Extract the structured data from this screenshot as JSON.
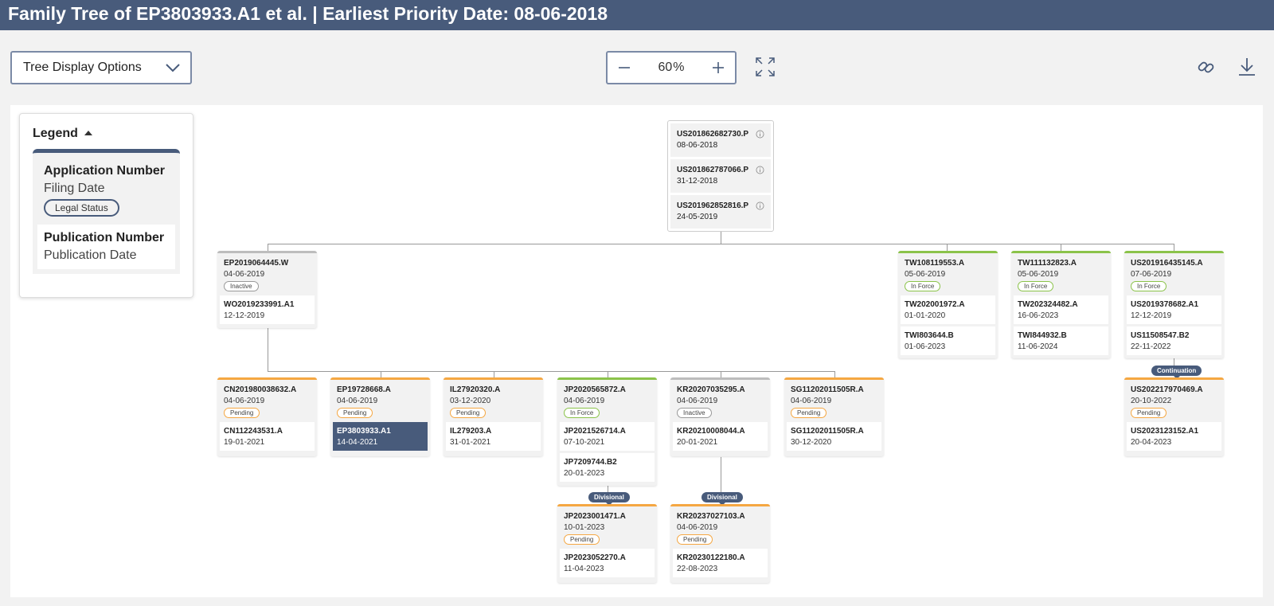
{
  "header": {
    "title": "Family Tree of EP3803933.A1 et al. | Earliest Priority Date: 08-06-2018"
  },
  "toolbar": {
    "tree_options_label": "Tree Display Options",
    "zoom_value": "60",
    "zoom_unit": "%"
  },
  "legend": {
    "title": "Legend",
    "application_number": "Application Number",
    "filing_date": "Filing Date",
    "legal_status": "Legal Status",
    "publication_number": "Publication Number",
    "publication_date": "Publication Date"
  },
  "root": [
    {
      "num": "US201862682730.P",
      "date": "08-06-2018"
    },
    {
      "num": "US201862787066.P",
      "date": "31-12-2018"
    },
    {
      "num": "US201962852816.P",
      "date": "24-05-2019"
    }
  ],
  "nodes": {
    "ep": {
      "num": "EP2019064445.W",
      "date": "04-06-2019",
      "status": "Inactive",
      "pubs": [
        {
          "num": "WO2019233991.A1",
          "date": "12-12-2019"
        }
      ]
    },
    "tw1": {
      "num": "TW108119553.A",
      "date": "05-06-2019",
      "status": "In Force",
      "pubs": [
        {
          "num": "TW202001972.A",
          "date": "01-01-2020"
        },
        {
          "num": "TWI803644.B",
          "date": "01-06-2023"
        }
      ]
    },
    "tw2": {
      "num": "TW111132823.A",
      "date": "05-06-2019",
      "status": "In Force",
      "pubs": [
        {
          "num": "TW202324482.A",
          "date": "16-06-2023"
        },
        {
          "num": "TWI844932.B",
          "date": "11-06-2024"
        }
      ]
    },
    "us": {
      "num": "US201916435145.A",
      "date": "07-06-2019",
      "status": "In Force",
      "pubs": [
        {
          "num": "US2019378682.A1",
          "date": "12-12-2019"
        },
        {
          "num": "US11508547.B2",
          "date": "22-11-2022"
        }
      ]
    },
    "cn": {
      "num": "CN201980038632.A",
      "date": "04-06-2019",
      "status": "Pending",
      "pubs": [
        {
          "num": "CN112243531.A",
          "date": "19-01-2021"
        }
      ]
    },
    "ep2": {
      "num": "EP19728668.A",
      "date": "04-06-2019",
      "status": "Pending",
      "pubs": [
        {
          "num": "EP3803933.A1",
          "date": "14-04-2021"
        }
      ]
    },
    "il": {
      "num": "IL27920320.A",
      "date": "03-12-2020",
      "status": "Pending",
      "pubs": [
        {
          "num": "IL279203.A",
          "date": "31-01-2021"
        }
      ]
    },
    "jp": {
      "num": "JP2020565872.A",
      "date": "04-06-2019",
      "status": "In Force",
      "pubs": [
        {
          "num": "JP2021526714.A",
          "date": "07-10-2021"
        },
        {
          "num": "JP7209744.B2",
          "date": "20-01-2023"
        }
      ]
    },
    "kr": {
      "num": "KR20207035295.A",
      "date": "04-06-2019",
      "status": "Inactive",
      "pubs": [
        {
          "num": "KR20210008044.A",
          "date": "20-01-2021"
        }
      ]
    },
    "sg": {
      "num": "SG11202011505R.A",
      "date": "04-06-2019",
      "status": "Pending",
      "pubs": [
        {
          "num": "SG11202011505R.A",
          "date": "30-12-2020"
        }
      ]
    },
    "us2": {
      "num": "US202217970469.A",
      "date": "20-10-2022",
      "status": "Pending",
      "pubs": [
        {
          "num": "US2023123152.A1",
          "date": "20-04-2023"
        }
      ]
    },
    "jp2": {
      "num": "JP2023001471.A",
      "date": "10-01-2023",
      "status": "Pending",
      "pubs": [
        {
          "num": "JP2023052270.A",
          "date": "11-04-2023"
        }
      ]
    },
    "kr2": {
      "num": "KR20237027103.A",
      "date": "04-06-2019",
      "status": "Pending",
      "pubs": [
        {
          "num": "KR20230122180.A",
          "date": "22-08-2023"
        }
      ]
    }
  },
  "relations": {
    "jp2": "Divisional",
    "kr2": "Divisional",
    "us2": "Continuation"
  }
}
